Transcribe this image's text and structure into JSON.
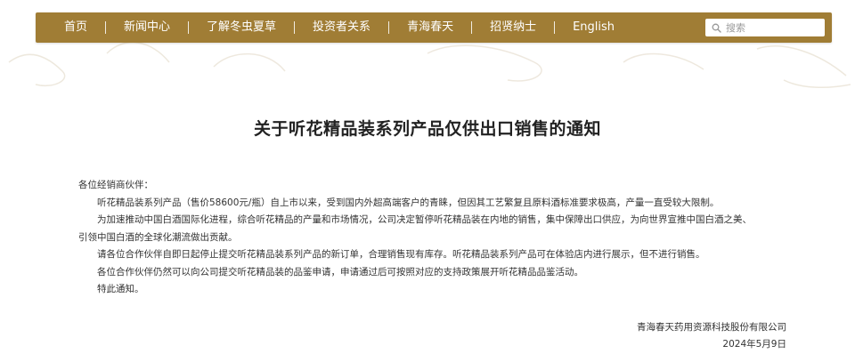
{
  "nav": {
    "items": [
      {
        "label": "首页"
      },
      {
        "label": "新闻中心"
      },
      {
        "label": "了解冬虫夏草"
      },
      {
        "label": "投资者关系"
      },
      {
        "label": "青海春天"
      },
      {
        "label": "招贤纳士"
      },
      {
        "label": "English"
      }
    ],
    "search_placeholder": "搜索",
    "bar_color": "#a07d35"
  },
  "article": {
    "title": "关于听花精品装系列产品仅供出口销售的通知",
    "salutation": "各位经销商伙伴：",
    "paragraphs": [
      "听花精品装系列产品（售价58600元/瓶）自上市以来，受到国内外超高端客户的青睐，但因其工艺繁复且原料酒标准要求极高，产量一直受较大限制。",
      "为加速推动中国白酒国际化进程，综合听花精品的产量和市场情况，公司决定暂停听花精品装在内地的销售，集中保障出口供应，为向世界宣推中国白酒之美、",
      "引领中国白酒的全球化潮流做出贡献。",
      "请各位合作伙伴自即日起停止提交听花精品装系列产品的新订单，合理销售现有库存。听花精品装系列产品可在体验店内进行展示，但不进行销售。",
      "各位合作伙伴仍然可以向公司提交听花精品装的品鉴申请，申请通过后可按照对应的支持政策展开听花精品品鉴活动。",
      "特此通知。"
    ],
    "signature_company": "青海春天药用资源科技股份有限公司",
    "signature_date": "2024年5月9日"
  }
}
